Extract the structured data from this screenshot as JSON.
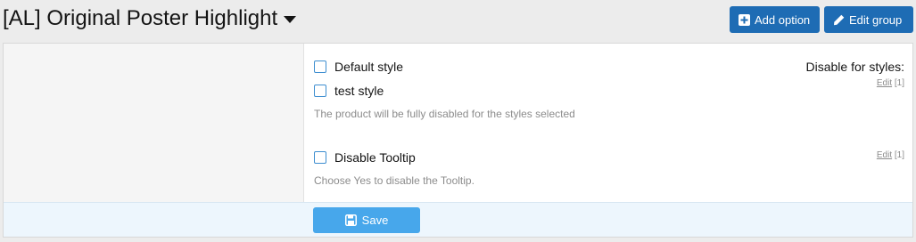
{
  "header": {
    "title": "[AL] Original Poster Highlight",
    "add_option_label": "Add option",
    "edit_group_label": "Edit group"
  },
  "rows": [
    {
      "label": "Disable for styles:",
      "edit_link": "Edit",
      "edit_count": "[1]",
      "options": [
        "Default style",
        "test style"
      ],
      "explain": "The product will be fully disabled for the styles selected"
    },
    {
      "label": "",
      "edit_link": "Edit",
      "edit_count": "[1]",
      "options": [
        "Disable Tooltip"
      ],
      "explain": "Choose Yes to disable the Tooltip."
    }
  ],
  "footer": {
    "save_label": "Save"
  },
  "colors": {
    "primary_button": "#1e6cb4",
    "save_button": "#47a7eb",
    "checkbox_border": "#3e8ed0",
    "footer_background": "#edf6fd"
  },
  "icons": {
    "title_menu": "caret-down-icon",
    "add_option": "plus-square-icon",
    "edit_group": "pencil-icon",
    "save": "floppy-disk-icon"
  }
}
